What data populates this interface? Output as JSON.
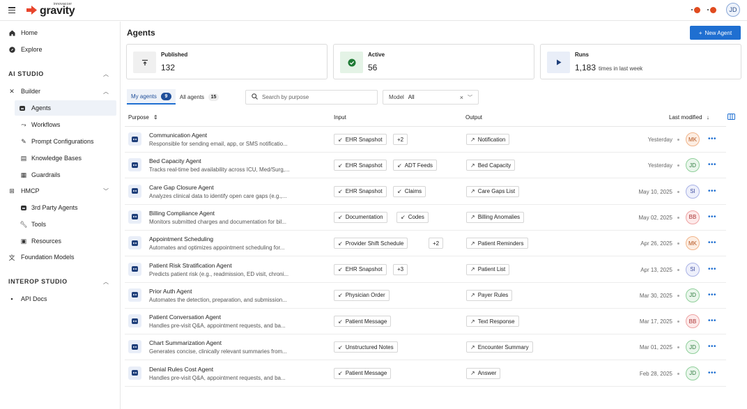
{
  "brand": {
    "small": "innovaccer",
    "name": "gravity"
  },
  "user": {
    "initials": "JD"
  },
  "sidebar": {
    "items": [
      {
        "label": "Home",
        "icon": "home-icon"
      },
      {
        "label": "Explore",
        "icon": "compass-icon"
      }
    ],
    "sections": [
      {
        "title": "AI STUDIO"
      },
      {
        "title": "INTEROP  STUDIO"
      }
    ],
    "builder": {
      "label": "Builder",
      "children": [
        "Agents",
        "Workflows",
        "Prompt Configurations",
        "Knowledge Bases",
        "Guardrails"
      ]
    },
    "hmcp": {
      "label": "HMCP",
      "children": [
        "3rd Party Agents",
        "Tools",
        "Resources"
      ]
    },
    "foundation": {
      "label": "Foundation Models"
    },
    "api_docs": {
      "label": "API Docs"
    }
  },
  "main": {
    "title": "Agents",
    "new_button": "New Agent",
    "stats": [
      {
        "label": "Published",
        "value": "132",
        "sub": ""
      },
      {
        "label": "Active",
        "value": "56",
        "sub": ""
      },
      {
        "label": "Runs",
        "value": "1,183",
        "sub": "times in last week"
      }
    ],
    "tabs": [
      {
        "label": "My agents",
        "count": "9"
      },
      {
        "label": "All agents",
        "count": "15"
      }
    ],
    "search_placeholder": "Search by purpose",
    "model_filter": {
      "label": "Model",
      "value": "All"
    },
    "columns": {
      "purpose": "Purpose",
      "input": "Input",
      "output": "Output",
      "modified": "Last modified"
    }
  },
  "rows": [
    {
      "name": "Communication Agent",
      "desc": "Responsible for sending email, app, or SMS notificatio...",
      "inputs": [
        "EHR Snapshot"
      ],
      "extra": "+2",
      "output": "Notification",
      "date": "Yesterday",
      "owner": "MK"
    },
    {
      "name": "Bed Capacity Agent",
      "desc": "Tracks real-time bed availability across ICU, Med/Surg,...",
      "inputs": [
        "EHR Snapshot",
        "ADT Feeds"
      ],
      "extra": "",
      "output": "Bed Capacity",
      "date": "Yesterday",
      "owner": "JD"
    },
    {
      "name": "Care Gap Closure Agent",
      "desc": "Analyzes clinical data to identify open care gaps (e.g.,...",
      "inputs": [
        "EHR Snapshot",
        "Claims"
      ],
      "extra": "",
      "output": "Care Gaps List",
      "date": "May 10, 2025",
      "owner": "SI"
    },
    {
      "name": "Billing Compliance Agent",
      "desc": "Monitors submitted charges and documentation for bil...",
      "inputs": [
        "Documentation",
        "Codes"
      ],
      "extra": "",
      "output": "Billing Anomalies",
      "date": "May 02, 2025",
      "owner": "BB"
    },
    {
      "name": "Appointment Scheduling",
      "desc": "Automates and optimizes appointment scheduling for...",
      "inputs": [
        "Provider Shift Schedule"
      ],
      "extra": "+2",
      "output": "Patient Reminders",
      "date": "Apr 26, 2025",
      "owner": "MK"
    },
    {
      "name": "Patient Risk Stratification Agent",
      "desc": "Predicts patient risk (e.g., readmission, ED visit, chroni...",
      "inputs": [
        "EHR Snapshot"
      ],
      "extra": "+3",
      "output": "Patient List",
      "date": "Apr 13, 2025",
      "owner": "SI"
    },
    {
      "name": "Prior Auth Agent",
      "desc": "Automates the detection, preparation, and submission...",
      "inputs": [
        "Physician Order"
      ],
      "extra": "",
      "output": "Payer Rules",
      "date": "Mar 30, 2025",
      "owner": "JD"
    },
    {
      "name": "Patient Conversation Agent",
      "desc": "Handles pre-visit Q&A, appointment requests, and ba...",
      "inputs": [
        "Patient Message"
      ],
      "extra": "",
      "output": "Text Response",
      "date": "Mar 17, 2025",
      "owner": "BB"
    },
    {
      "name": "Chart Summarization Agent",
      "desc": "Generates concise, clinically relevant summaries from...",
      "inputs": [
        "Unstructured Notes"
      ],
      "extra": "",
      "output": "Encounter Summary",
      "date": "Mar 01, 2025",
      "owner": "JD"
    },
    {
      "name": "Denial Rules Cost Agent",
      "desc": "Handles pre-visit Q&A, appointment requests, and ba...",
      "inputs": [
        "Patient Message"
      ],
      "extra": "",
      "output": "Answer",
      "date": "Feb 28, 2025",
      "owner": "JD"
    }
  ],
  "avatar_colors": {
    "MK": {
      "bg": "#fdeee3",
      "border": "#f1b48a",
      "fg": "#b4531d"
    },
    "JD": {
      "bg": "#eaf6ec",
      "border": "#8fcf9a",
      "fg": "#2e7a3e"
    },
    "SI": {
      "bg": "#eef0fb",
      "border": "#a9b2e6",
      "fg": "#3c4a9e"
    },
    "BB": {
      "bg": "#fdeaea",
      "border": "#eea3a3",
      "fg": "#a83232"
    }
  },
  "accent": "#1f6fd1"
}
